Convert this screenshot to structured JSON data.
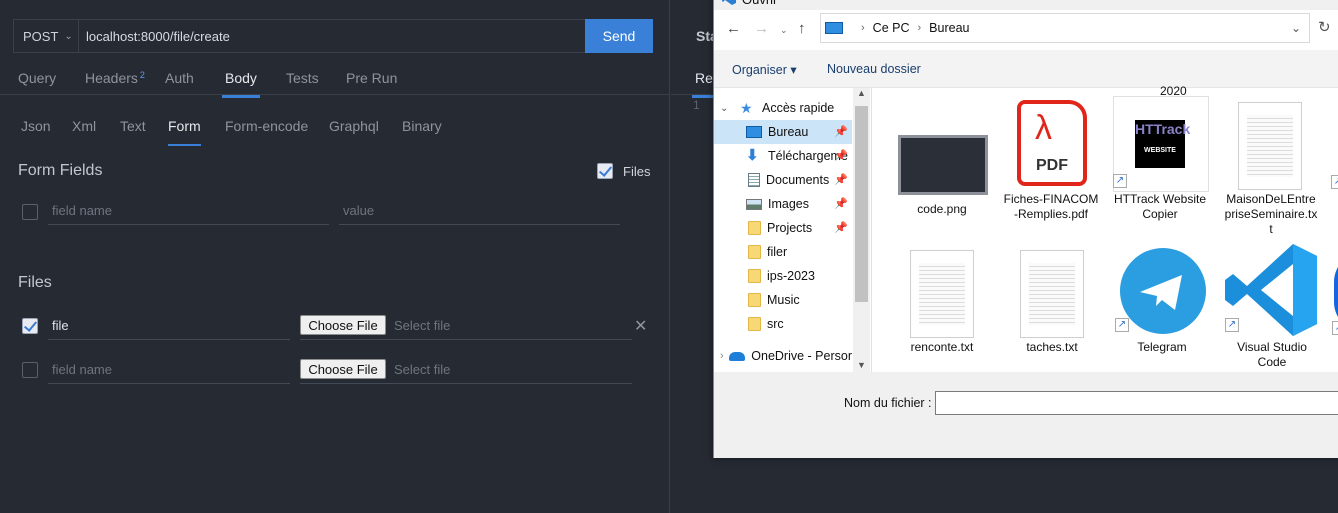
{
  "request": {
    "method": "POST",
    "url": "localhost:8000/file/create",
    "send_label": "Send"
  },
  "tabs": [
    {
      "label": "Query"
    },
    {
      "label": "Headers",
      "badge": "2"
    },
    {
      "label": "Auth"
    },
    {
      "label": "Body",
      "active": true
    },
    {
      "label": "Tests"
    },
    {
      "label": "Pre Run"
    }
  ],
  "body_tabs": [
    {
      "label": "Json"
    },
    {
      "label": "Xml"
    },
    {
      "label": "Text"
    },
    {
      "label": "Form",
      "active": true
    },
    {
      "label": "Form-encode"
    },
    {
      "label": "Graphql"
    },
    {
      "label": "Binary"
    }
  ],
  "form": {
    "title": "Form Fields",
    "files_toggle_label": "Files",
    "files_toggle_checked": true,
    "field_name_placeholder": "field name",
    "value_placeholder": "value"
  },
  "files": {
    "title": "Files",
    "rows": [
      {
        "checked": true,
        "name": "file",
        "choose_label": "Choose File",
        "select_placeholder": "Select file"
      },
      {
        "checked": false,
        "name_placeholder": "field name",
        "choose_label": "Choose File",
        "select_placeholder": "Select file"
      }
    ]
  },
  "response": {
    "status_label": "Sta",
    "tab_label": "Res",
    "line_number": "1"
  },
  "dialog": {
    "title": "Ouvrir",
    "path": [
      "Ce PC",
      "Bureau"
    ],
    "toolbar": {
      "organise": "Organiser ▾",
      "new_folder": "Nouveau dossier"
    },
    "nav": [
      {
        "label": "Accès rapide",
        "type": "quick"
      },
      {
        "label": "Bureau",
        "type": "desktop",
        "pinned": true,
        "selected": true
      },
      {
        "label": "Téléchargeme",
        "type": "download",
        "pinned": true
      },
      {
        "label": "Documents",
        "type": "docs",
        "pinned": true
      },
      {
        "label": "Images",
        "type": "images",
        "pinned": true
      },
      {
        "label": "Projects",
        "type": "folder",
        "pinned": true
      },
      {
        "label": "filer",
        "type": "folder"
      },
      {
        "label": "ips-2023",
        "type": "folder"
      },
      {
        "label": "Music",
        "type": "folder"
      },
      {
        "label": "src",
        "type": "folder"
      },
      {
        "label": "OneDrive - Persor",
        "type": "cloud"
      }
    ],
    "items_top_caption": "2020",
    "items": [
      {
        "name": "code.png"
      },
      {
        "name": "Fiches-FINACOM-Remplies.pdf",
        "l1": "Fiches-FINACOM",
        "l2": "-Remplies.pdf"
      },
      {
        "name": "HTTrack Website Copier",
        "l1": "HTTrack Website",
        "l2": "Copier",
        "logo": "HTTrack",
        "logo_sub": "WEBSITE COPIER"
      },
      {
        "name": "MaisonDeLEntrepriseSeminaire.txt",
        "l1": "MaisonDeLEntre",
        "l2": "priseSeminaire.tx",
        "l3": "t"
      },
      {
        "name": "renconte.txt"
      },
      {
        "name": "taches.txt"
      },
      {
        "name": "Telegram"
      },
      {
        "name": "Visual Studio Code",
        "l1": "Visual Studio",
        "l2": "Code"
      }
    ],
    "pdf_label": "PDF",
    "filename_label": "Nom du fichier :",
    "filename_value": ""
  }
}
